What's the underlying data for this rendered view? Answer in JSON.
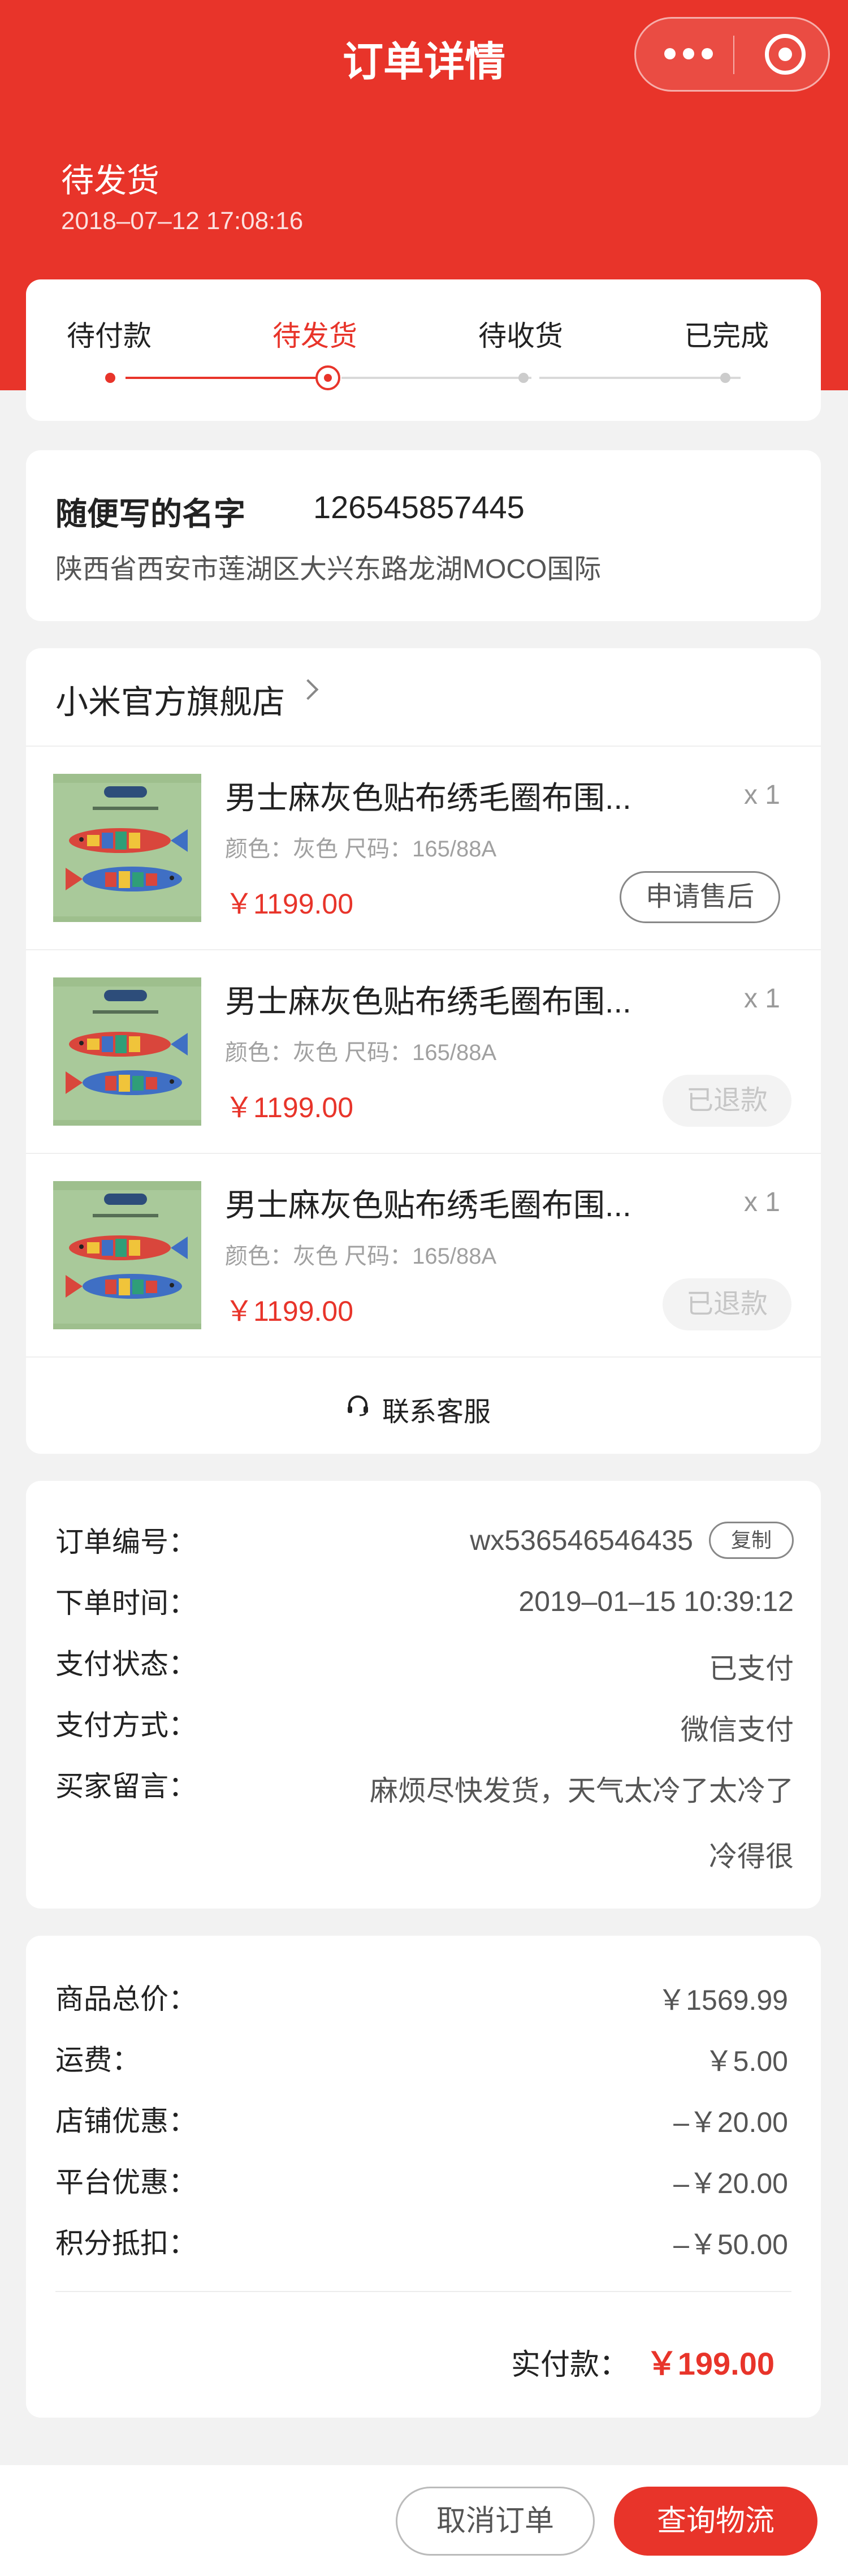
{
  "nav": {
    "title": "订单详情",
    "more_icon": "more-dots-icon",
    "close_icon": "target-close-icon"
  },
  "status": {
    "title": "待发货",
    "time": "2018–07–12   17:08:16"
  },
  "steps": [
    "待付款",
    "待发货",
    "待收货",
    "已完成"
  ],
  "current_step": 1,
  "address": {
    "name": "随便写的名字",
    "phone": "126545857445",
    "line": "陕西省西安市莲湖区大兴东路龙湖MOCO国际"
  },
  "shop": {
    "name": "小米官方旗舰店"
  },
  "items": [
    {
      "title": "男士麻灰色贴布绣毛圈布围...",
      "qty": "x 1",
      "spec": "颜色：灰色  尺码：165/88A",
      "price": "￥1199.00",
      "action": "申请售后"
    },
    {
      "title": "男士麻灰色贴布绣毛圈布围...",
      "qty": "x 1",
      "spec": "颜色：灰色  尺码：165/88A",
      "price": "￥1199.00",
      "action": "已退款"
    },
    {
      "title": "男士麻灰色贴布绣毛圈布围...",
      "qty": "x 1",
      "spec": "颜色：灰色  尺码：165/88A",
      "price": "￥1199.00",
      "action": "已退款"
    }
  ],
  "contact": {
    "label": "联系客服",
    "icon": "headset-icon"
  },
  "order": {
    "number_label": "订单编号：",
    "number": "wx536546546435",
    "copy": "复制",
    "time_label": "下单时间：",
    "time": "2019–01–15 10:39:12",
    "pay_status_label": "支付状态：",
    "pay_status": "已支付",
    "pay_method_label": "支付方式：",
    "pay_method": "微信支付",
    "message_label": "买家留言：",
    "message_1": "麻烦尽快发货，天气太冷了太冷了",
    "message_2": "冷得很"
  },
  "money": {
    "total_label": "商品总价：",
    "total": "￥1569.99",
    "freight_label": "运费：",
    "freight": "￥5.00",
    "shop_discount_label": "店铺优惠：",
    "shop_discount": "–￥20.00",
    "platform_discount_label": "平台优惠：",
    "platform_discount": "–￥20.00",
    "points_label": "积分抵扣：",
    "points": "–￥50.00",
    "paid_label": "实付款：",
    "paid": "￥199.00"
  },
  "actions": {
    "cancel": "取消订单",
    "track": "查询物流"
  },
  "colors": {
    "brand": "#e8342a",
    "background": "#f2f2f2"
  }
}
